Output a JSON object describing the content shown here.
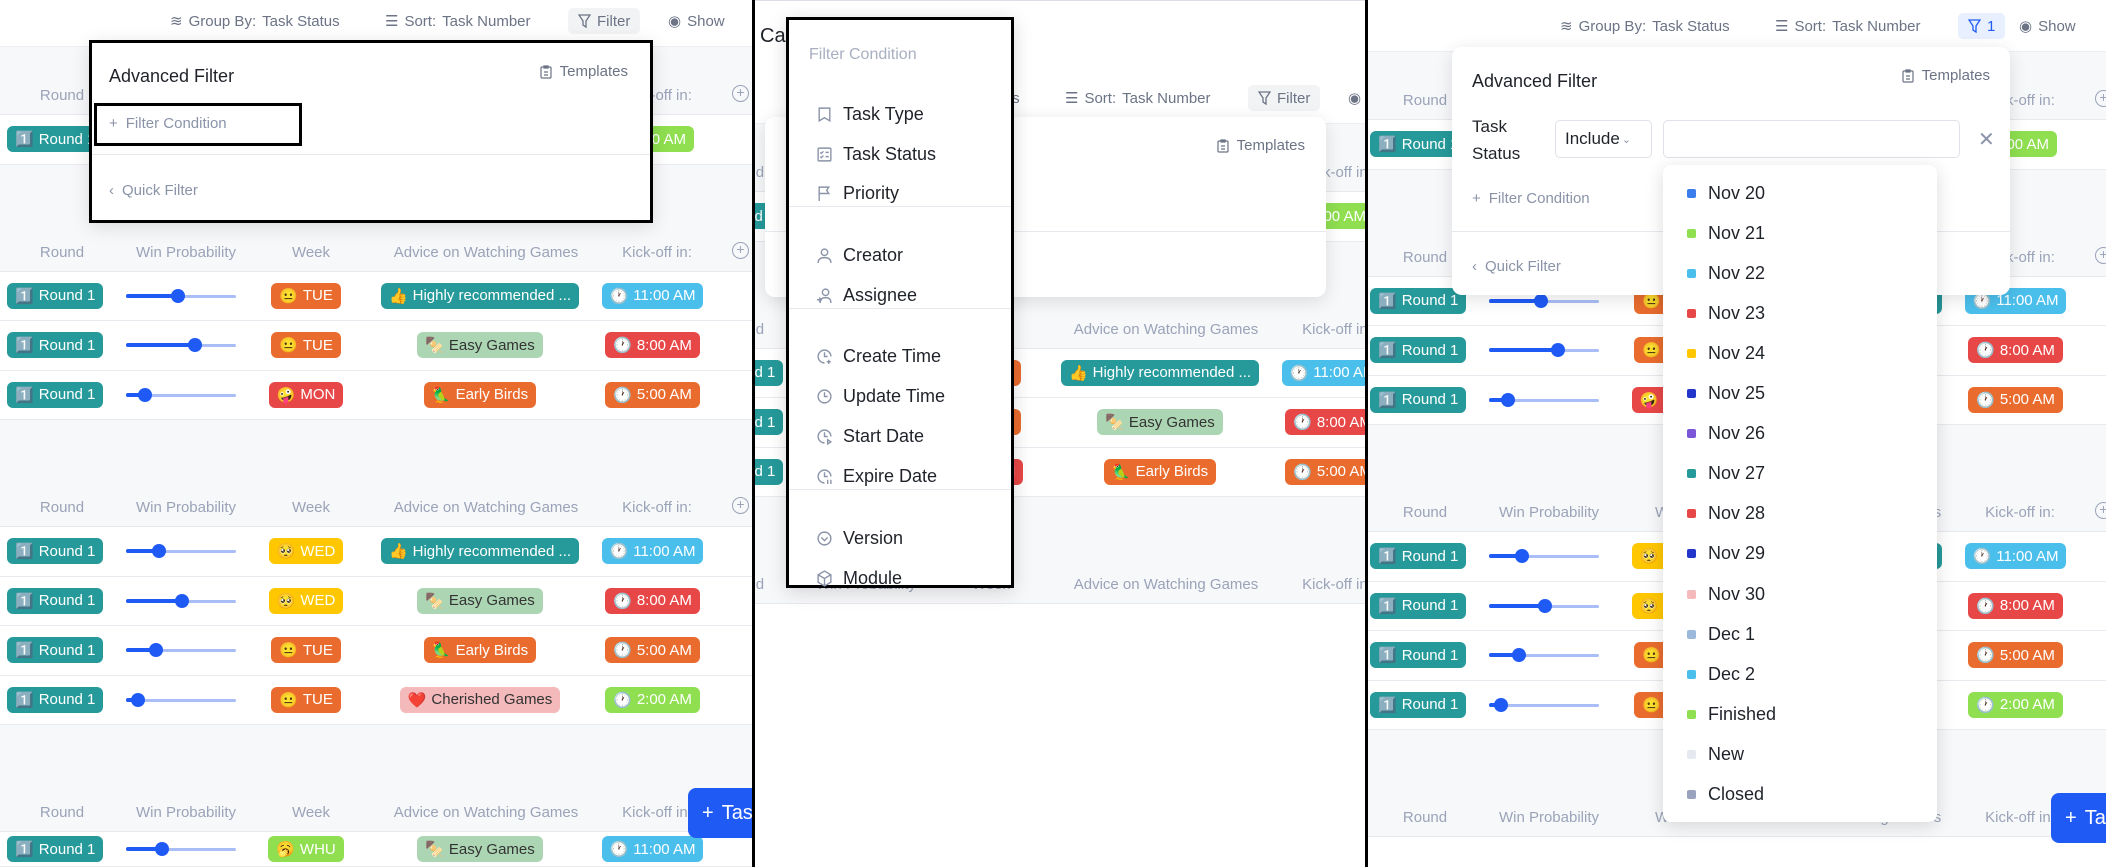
{
  "toolbar": {
    "group_by_label": "Group By:",
    "group_by_value": "Task Status",
    "sort_label": "Sort:",
    "sort_value": "Task Number",
    "filter_label": "Filter",
    "show_label": "Show",
    "active_filter_count": "1"
  },
  "colors": {
    "teal": "#26999a",
    "orange": "#e96c2e",
    "red": "#e84747",
    "yellow": "#ffc700",
    "green": "#8fdf50",
    "blue": "#4bbfec",
    "mint": "#acd6b3",
    "pink": "#f3b9bb",
    "accent": "#1f5af5"
  },
  "table": {
    "columns": [
      "Round",
      "Win Probability",
      "Week",
      "Advice on Watching Games",
      "Kick-off in:"
    ],
    "groups": [
      {
        "rows": [
          {
            "round": "Round 1",
            "kick": {
              "label": "00 AM",
              "color": "green",
              "partial": true
            }
          }
        ]
      },
      {
        "rows": [
          {
            "round": "Round 1",
            "win": 0.47,
            "week": {
              "emoji": "😐",
              "label": "TUE",
              "color": "orange"
            },
            "advice": {
              "emoji": "👍",
              "label": "Highly recommended ...",
              "color": "teal"
            },
            "kick": {
              "label": "11:00 AM",
              "color": "blue"
            }
          },
          {
            "round": "Round 1",
            "win": 0.63,
            "week": {
              "emoji": "😐",
              "label": "TUE",
              "color": "orange"
            },
            "advice": {
              "emoji": "🍢",
              "label": "Easy Games",
              "color": "mint"
            },
            "kick": {
              "label": "8:00 AM",
              "color": "red"
            }
          },
          {
            "round": "Round 1",
            "win": 0.17,
            "week": {
              "emoji": "🤪",
              "label": "MON",
              "color": "red"
            },
            "advice": {
              "emoji": "🦜",
              "label": "Early Birds",
              "color": "orange"
            },
            "kick": {
              "label": "5:00 AM",
              "color": "orange"
            }
          }
        ]
      },
      {
        "rows": [
          {
            "round": "Round 1",
            "win": 0.3,
            "week": {
              "emoji": "🥺",
              "label": "WED",
              "color": "yellow"
            },
            "advice": {
              "emoji": "👍",
              "label": "Highly recommended ...",
              "color": "teal"
            },
            "kick": {
              "label": "11:00 AM",
              "color": "blue"
            }
          },
          {
            "round": "Round 1",
            "win": 0.51,
            "week": {
              "emoji": "🥺",
              "label": "WED",
              "color": "yellow"
            },
            "advice": {
              "emoji": "🍢",
              "label": "Easy Games",
              "color": "mint"
            },
            "kick": {
              "label": "8:00 AM",
              "color": "red"
            }
          },
          {
            "round": "Round 1",
            "win": 0.27,
            "week": {
              "emoji": "😐",
              "label": "TUE",
              "color": "orange"
            },
            "advice": {
              "emoji": "🦜",
              "label": "Early Birds",
              "color": "orange"
            },
            "kick": {
              "label": "5:00 AM",
              "color": "orange"
            }
          },
          {
            "round": "Round 1",
            "win": 0.11,
            "week": {
              "emoji": "😐",
              "label": "TUE",
              "color": "orange"
            },
            "advice": {
              "emoji": "❤️",
              "label": "Cherished Games",
              "color": "pink"
            },
            "kick": {
              "label": "2:00 AM",
              "color": "green"
            }
          }
        ]
      },
      {
        "rows": [
          {
            "round": "Round 1",
            "win": 0.33,
            "week": {
              "emoji": "🥱",
              "label": "WHU",
              "color": "green"
            },
            "advice": {
              "emoji": "🍢",
              "label": "Easy Games",
              "color": "mint"
            },
            "kick": {
              "label": "11:00 AM",
              "color": "blue"
            }
          }
        ]
      }
    ]
  },
  "panels": [
    {
      "group_row_counts": [
        1,
        3,
        4,
        1
      ],
      "filter_active": false
    },
    {
      "title_fragment": "Ca",
      "group_row_counts": [
        1,
        3,
        0
      ],
      "filter_active": false
    },
    {
      "group_row_counts": [
        1,
        3,
        4,
        0
      ],
      "filter_active": true
    }
  ],
  "add_task_label": "Task",
  "advanced_filter": {
    "title": "Advanced Filter",
    "templates_label": "Templates",
    "add_condition_label": "Filter Condition",
    "quick_filter_label": "Quick Filter"
  },
  "condition_row": {
    "field_label": "Task Status",
    "operator": "Include",
    "value": ""
  },
  "condition_menu": {
    "label": "Filter Condition",
    "sections": [
      [
        {
          "icon": "bookmark-icon",
          "label": "Task Type"
        },
        {
          "icon": "checklist-icon",
          "label": "Task Status"
        },
        {
          "icon": "flag-icon",
          "label": "Priority"
        }
      ],
      [
        {
          "icon": "user-icon",
          "label": "Creator"
        },
        {
          "icon": "user-assign-icon",
          "label": "Assignee"
        }
      ],
      [
        {
          "icon": "clock-plus-icon",
          "label": "Create Time"
        },
        {
          "icon": "clock-icon",
          "label": "Update Time"
        },
        {
          "icon": "clock-start-icon",
          "label": "Start Date"
        },
        {
          "icon": "clock-end-icon",
          "label": "Expire Date"
        }
      ],
      [
        {
          "icon": "version-icon",
          "label": "Version"
        },
        {
          "icon": "cube-icon",
          "label": "Module"
        }
      ]
    ]
  },
  "status_options": [
    {
      "label": "Nov 20",
      "color": "#3b7ded"
    },
    {
      "label": "Nov 21",
      "color": "#8fdf50"
    },
    {
      "label": "Nov 22",
      "color": "#4bbfec"
    },
    {
      "label": "Nov 23",
      "color": "#e84747"
    },
    {
      "label": "Nov 24",
      "color": "#ffc700"
    },
    {
      "label": "Nov 25",
      "color": "#2236cc"
    },
    {
      "label": "Nov 26",
      "color": "#7b56d6"
    },
    {
      "label": "Nov 27",
      "color": "#26999a"
    },
    {
      "label": "Nov 28",
      "color": "#e84747"
    },
    {
      "label": "Nov 29",
      "color": "#2236cc"
    },
    {
      "label": "Nov 30",
      "color": "#f3b9bb"
    },
    {
      "label": "Dec 1",
      "color": "#9cb9dc"
    },
    {
      "label": "Dec 2",
      "color": "#4bbfec"
    },
    {
      "label": "Finished",
      "color": "#8fdf50"
    },
    {
      "label": "New",
      "color": "#e6e9f0"
    },
    {
      "label": "Closed",
      "color": "#9aa3bd"
    }
  ]
}
